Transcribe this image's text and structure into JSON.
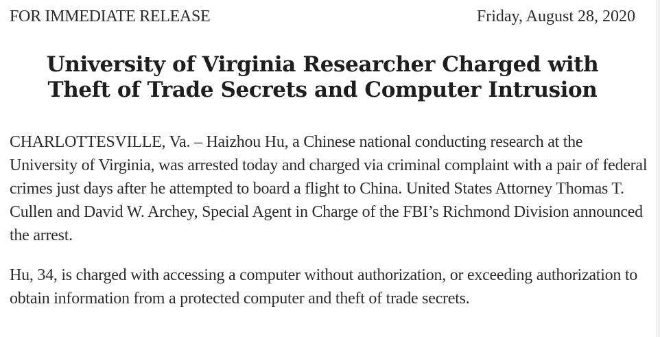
{
  "header": {
    "release_label": "FOR IMMEDIATE RELEASE",
    "date": "Friday, August 28, 2020"
  },
  "article": {
    "title_line_1": "University of Virginia Researcher Charged with",
    "title_line_2": "Theft of Trade Secrets and Computer Intrusion",
    "paragraphs": [
      "CHARLOTTESVILLE, Va. – Haizhou Hu, a Chinese national conducting research at the University of Virginia, was arrested today and charged via criminal complaint with a pair of federal crimes just days after he attempted to board a flight to China. United States Attorney Thomas T. Cullen and David W. Archey, Special Agent in Charge of the FBI’s Richmond Division announced the arrest.",
      "Hu, 34, is charged with accessing a computer without authorization, or exceeding authorization to obtain information from a protected computer and theft of trade secrets."
    ]
  }
}
